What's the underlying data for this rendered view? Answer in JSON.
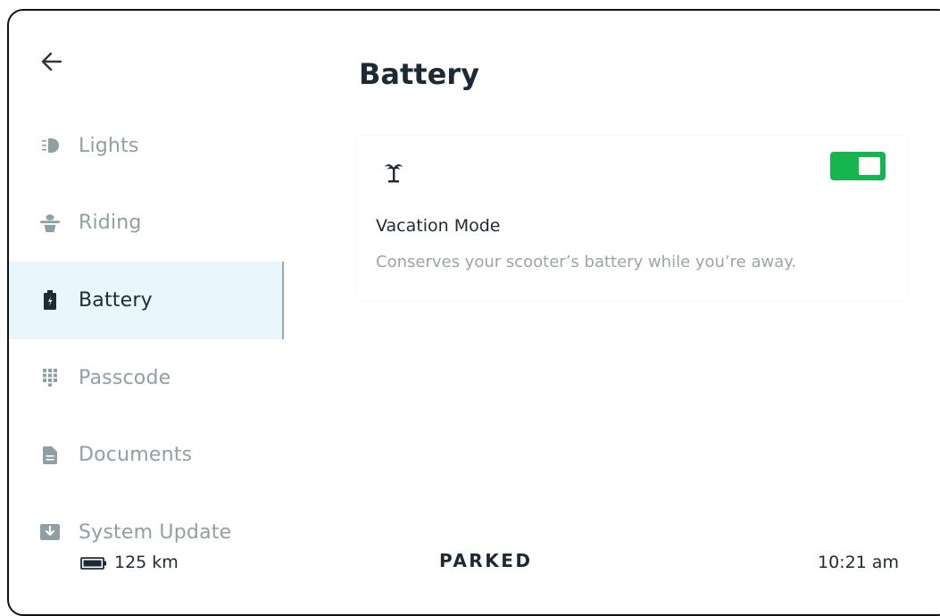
{
  "header": {
    "back_icon": "arrow-left-icon",
    "title": "Battery"
  },
  "sidebar": {
    "items": [
      {
        "label": "Lights",
        "icon": "headlight-icon",
        "active": false
      },
      {
        "label": "Riding",
        "icon": "rider-icon",
        "active": false
      },
      {
        "label": "Battery",
        "icon": "battery-icon",
        "active": true
      },
      {
        "label": "Passcode",
        "icon": "keypad-icon",
        "active": false
      },
      {
        "label": "Documents",
        "icon": "document-icon",
        "active": false
      },
      {
        "label": "System Update",
        "icon": "download-icon",
        "active": false
      }
    ]
  },
  "vacation_card": {
    "icon": "palm-tree-icon",
    "title": "Vacation Mode",
    "description": "Conserves your scooter’s battery while you’re away.",
    "toggle_on": true
  },
  "status_bar": {
    "range": "125 km",
    "state": "PARKED",
    "time": "10:21 am"
  },
  "colors": {
    "accent_green": "#17b54f",
    "active_bg": "#e9f6fb",
    "text_dark": "#1c2a35",
    "text_muted": "#8fa0a4"
  }
}
